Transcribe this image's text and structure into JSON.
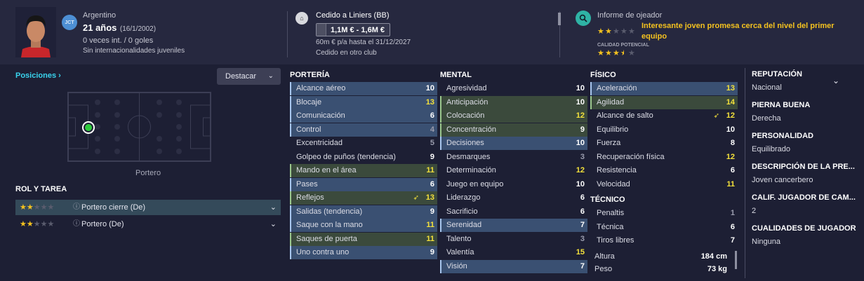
{
  "header": {
    "badge": "JCT",
    "nationality": "Argentino",
    "age": "21 años",
    "dob": "(16/1/2002)",
    "caps": "0 veces int. / 0 goles",
    "intl_note": "Sin internacionalidades juveniles",
    "loan_title": "Cedido a Liniers (BB)",
    "value_range": "1,1M € - 1,6M €",
    "wage": "60m € p/a hasta el 31/12/2027",
    "loan_note": "Cedido en otro club",
    "scout_title": "Informe de ojeador",
    "scout_text": "Interesante joven promesa cerca del nivel del primer equipo",
    "potential_label": "CALIDAD POTENCIAL",
    "current_stars": 2,
    "potential_stars": 3.5,
    "accent": "#f4c21f"
  },
  "left": {
    "positions_label": "Posiciones",
    "highlight_label": "Destacar",
    "position_name": "Portero",
    "role_header": "ROL Y TAREA",
    "roles": [
      {
        "name": "Portero cierre (De)",
        "stars": 2
      },
      {
        "name": "Portero (De)",
        "stars": 2
      }
    ]
  },
  "porteria": {
    "title": "PORTERÍA",
    "rows": [
      {
        "label": "Alcance aéreo",
        "value": "10",
        "style": "hl",
        "color": "w"
      },
      {
        "label": "Blocaje",
        "value": "13",
        "style": "hl",
        "color": "y"
      },
      {
        "label": "Comunicación",
        "value": "6",
        "style": "hl",
        "color": "w"
      },
      {
        "label": "Control",
        "value": "4",
        "style": "hl",
        "color": "g"
      },
      {
        "label": "Excentricidad",
        "value": "5",
        "style": "",
        "color": "g"
      },
      {
        "label": "Golpeo de puños (tendencia)",
        "value": "9",
        "style": "",
        "color": "w"
      },
      {
        "label": "Mando en el área",
        "value": "11",
        "style": "hl-g",
        "color": "y"
      },
      {
        "label": "Pases",
        "value": "6",
        "style": "hl",
        "color": "w"
      },
      {
        "label": "Reflejos",
        "value": "13",
        "style": "hl-g",
        "color": "y",
        "arrow": true
      },
      {
        "label": "Salidas (tendencia)",
        "value": "9",
        "style": "hl",
        "color": "w"
      },
      {
        "label": "Saque con la mano",
        "value": "11",
        "style": "hl",
        "color": "y"
      },
      {
        "label": "Saques de puerta",
        "value": "11",
        "style": "hl-g",
        "color": "y"
      },
      {
        "label": "Uno contra uno",
        "value": "9",
        "style": "hl",
        "color": "w"
      }
    ]
  },
  "mental": {
    "title": "MENTAL",
    "rows": [
      {
        "label": "Agresividad",
        "value": "10",
        "style": "",
        "color": "w"
      },
      {
        "label": "Anticipación",
        "value": "10",
        "style": "hl-g",
        "color": "w"
      },
      {
        "label": "Colocación",
        "value": "12",
        "style": "hl-g",
        "color": "y"
      },
      {
        "label": "Concentración",
        "value": "9",
        "style": "hl-g",
        "color": "w"
      },
      {
        "label": "Decisiones",
        "value": "10",
        "style": "hl",
        "color": "w"
      },
      {
        "label": "Desmarques",
        "value": "3",
        "style": "",
        "color": "g"
      },
      {
        "label": "Determinación",
        "value": "12",
        "style": "",
        "color": "y"
      },
      {
        "label": "Juego en equipo",
        "value": "10",
        "style": "",
        "color": "w"
      },
      {
        "label": "Liderazgo",
        "value": "6",
        "style": "",
        "color": "w"
      },
      {
        "label": "Sacrificio",
        "value": "6",
        "style": "",
        "color": "w"
      },
      {
        "label": "Serenidad",
        "value": "7",
        "style": "hl",
        "color": "w"
      },
      {
        "label": "Talento",
        "value": "3",
        "style": "",
        "color": "g"
      },
      {
        "label": "Valentía",
        "value": "15",
        "style": "",
        "color": "y"
      },
      {
        "label": "Visión",
        "value": "7",
        "style": "hl",
        "color": "w"
      }
    ]
  },
  "fisico": {
    "title": "FÍSICO",
    "rows": [
      {
        "label": "Aceleración",
        "value": "13",
        "style": "hl",
        "color": "y"
      },
      {
        "label": "Agilidad",
        "value": "14",
        "style": "hl-g",
        "color": "y"
      },
      {
        "label": "Alcance de salto",
        "value": "12",
        "style": "",
        "color": "y",
        "arrow": true
      },
      {
        "label": "Equilibrio",
        "value": "10",
        "style": "",
        "color": "w"
      },
      {
        "label": "Fuerza",
        "value": "8",
        "style": "",
        "color": "w"
      },
      {
        "label": "Recuperación física",
        "value": "12",
        "style": "",
        "color": "y"
      },
      {
        "label": "Resistencia",
        "value": "6",
        "style": "",
        "color": "w"
      },
      {
        "label": "Velocidad",
        "value": "11",
        "style": "",
        "color": "y"
      }
    ]
  },
  "tecnico": {
    "title": "TÉCNICO",
    "rows": [
      {
        "label": "Penaltis",
        "value": "1",
        "style": "",
        "color": "g"
      },
      {
        "label": "Técnica",
        "value": "6",
        "style": "",
        "color": "w"
      },
      {
        "label": "Tiros libres",
        "value": "7",
        "style": "",
        "color": "w"
      }
    ]
  },
  "body": {
    "height_label": "Altura",
    "height": "184 cm",
    "weight_label": "Peso",
    "weight": "73 kg"
  },
  "info": [
    {
      "label": "REPUTACIÓN",
      "value": "Nacional"
    },
    {
      "label": "PIERNA BUENA",
      "value": "Derecha"
    },
    {
      "label": "PERSONALIDAD",
      "value": "Equilibrado"
    },
    {
      "label": "DESCRIPCIÓN DE LA PRE...",
      "value": "Joven cancerbero"
    },
    {
      "label": "CALIF. JUGADOR DE CAM...",
      "value": "2"
    },
    {
      "label": "CUALIDADES DE JUGADOR",
      "value": "Ninguna"
    }
  ]
}
